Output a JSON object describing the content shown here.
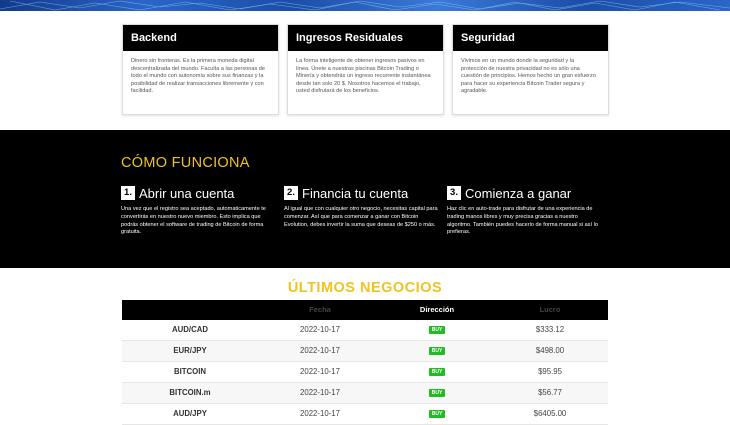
{
  "cards": [
    {
      "title": "Backend",
      "text": "Dinero sin fronteras. Es la primera moneda digital descentralizada del mundo. Faculta a las personas de todo el mundo con autonomía sobre sus finanzas y la posibilidad de realizar transacciones libremente y con facilidad."
    },
    {
      "title": "Ingresos Residuales",
      "text": "La forma inteligente de obtener ingresos pasivos en línea. Únete a nuestras piscinas Bitcoin Trading o Minería y obtendrás un ingreso recurrente instantánea desde tan solo 20 $. Nosotros hacemos el trabajo, usted disfrutará de los beneficios."
    },
    {
      "title": "Seguridad",
      "text": "Vivimos en un mundo donde la seguridad y la protección de nuestra privacidad no es sólo una cuestión de principios. Hemos hecho un gran esfuerzo para hacer su experiencia Bitcoin Trader segura y agradable."
    }
  ],
  "how": {
    "title": "CÓMO FUNCIONA",
    "steps": [
      {
        "num": "1.",
        "title": "Abrir una cuenta",
        "text": "Una vez que el registro sea aceptado, automaticamente te convertirás en nuestro nuevo miembro. Esto implica que podrás obtener el software de trading de Bitcoin de forma gratuita."
      },
      {
        "num": "2.",
        "title": "Financia tu cuenta",
        "text": "Al igual que con cualquier otro negocio, necesitas capital para comenzar. Así que para comenzar a ganar con Bitcoin Evolution, debes invertir la suma que deseas de $250 o más."
      },
      {
        "num": "3.",
        "title": "Comienza a ganar",
        "text": "Haz clic en auto-trade para disfrutar de una experiencia de trading manos libres y muy precisa gracias a nuestro algoritmo. También puedes hacerlo de forma manual si así lo prefieras."
      }
    ]
  },
  "deals": {
    "title": "ÚLTIMOS NEGOCIOS",
    "headers": [
      "",
      "Fecha",
      "Dirección",
      "Lucro"
    ],
    "rows": [
      {
        "asset": "AUD/CAD",
        "date": "2022-10-17",
        "direction": "BUY",
        "profit": "$333.12"
      },
      {
        "asset": "EUR/JPY",
        "date": "2022-10-17",
        "direction": "BUY",
        "profit": "$498.00"
      },
      {
        "asset": "BITCOIN",
        "date": "2022-10-17",
        "direction": "BUY",
        "profit": "$95.95"
      },
      {
        "asset": "BITCOIN.m",
        "date": "2022-10-17",
        "direction": "BUY",
        "profit": "$56.77"
      },
      {
        "asset": "AUD/JPY",
        "date": "2022-10-17",
        "direction": "BUY",
        "profit": "$6405.00"
      }
    ]
  },
  "colors": {
    "accent": "#f0c420",
    "buy": "#22bb22",
    "dark": "#000000"
  }
}
